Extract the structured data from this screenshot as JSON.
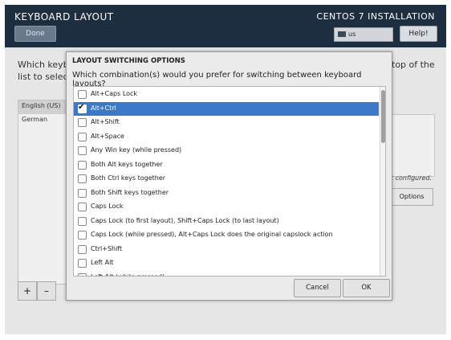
{
  "header": {
    "title": "KEYBOARD LAYOUT",
    "product": "CENTOS 7 INSTALLATION",
    "done_label": "Done",
    "keyboard_indicator": "us",
    "help_label": "Help!"
  },
  "background": {
    "description_line1": "Which keyb",
    "description_line2": "list to selec",
    "description_tail": "top of the",
    "layouts": [
      "English (US)",
      "German"
    ],
    "add_label": "+",
    "remove_label": "–",
    "not_configured": "ot configured.",
    "options_label": "Options"
  },
  "dialog": {
    "title": "LAYOUT SWITCHING OPTIONS",
    "question": "Which combination(s) would you prefer for switching between keyboard layouts?",
    "options": [
      {
        "label": "Alt+Caps Lock",
        "checked": false
      },
      {
        "label": "Alt+Ctrl",
        "checked": true
      },
      {
        "label": "Alt+Shift",
        "checked": false
      },
      {
        "label": "Alt+Space",
        "checked": false
      },
      {
        "label": "Any Win key (while pressed)",
        "checked": false
      },
      {
        "label": "Both Alt keys together",
        "checked": false
      },
      {
        "label": "Both Ctrl keys together",
        "checked": false
      },
      {
        "label": "Both Shift keys together",
        "checked": false
      },
      {
        "label": "Caps Lock",
        "checked": false
      },
      {
        "label": "Caps Lock (to first layout), Shift+Caps Lock (to last layout)",
        "checked": false
      },
      {
        "label": "Caps Lock (while pressed), Alt+Caps Lock does the original capslock action",
        "checked": false
      },
      {
        "label": "Ctrl+Shift",
        "checked": false
      },
      {
        "label": "Left Alt",
        "checked": false
      },
      {
        "label": "Left Alt (while pressed)",
        "checked": false
      }
    ],
    "cancel_label": "Cancel",
    "ok_label": "OK"
  }
}
